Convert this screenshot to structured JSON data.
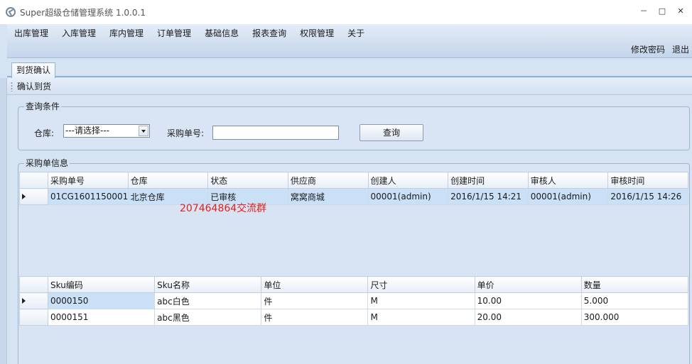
{
  "window": {
    "title": "Super超级仓储管理系统 1.0.0.1",
    "controls": [
      "－",
      "□",
      "✕"
    ]
  },
  "menu": {
    "items": [
      "出库管理",
      "入库管理",
      "库内管理",
      "订单管理",
      "基础信息",
      "报表查询",
      "权限管理",
      "关于"
    ]
  },
  "userbar": {
    "change_password": "修改密码",
    "logout": "退出"
  },
  "tabs": [
    {
      "label": "到货确认",
      "active": true
    }
  ],
  "toolbar": {
    "confirm_label": "确认到货"
  },
  "query": {
    "group_title": "查询条件",
    "warehouse_label": "仓库:",
    "warehouse_value": "---请选择---",
    "po_label": "采购单号:",
    "po_value": "",
    "search_label": "查询"
  },
  "po_info": {
    "group_title": "采购单信息",
    "columns": [
      "采购单号",
      "仓库",
      "状态",
      "供应商",
      "创建人",
      "创建时间",
      "审核人",
      "审核时间"
    ],
    "rows": [
      [
        "01CG1601150001",
        "北京仓库",
        "已审核",
        "窝窝商城",
        "00001(admin)",
        "2016/1/15 14:21",
        "00001(admin)",
        "2016/1/15 14:26"
      ]
    ]
  },
  "sku_grid": {
    "columns": [
      "Sku编码",
      "Sku名称",
      "单位",
      "尺寸",
      "单价",
      "数量"
    ],
    "rows": [
      [
        "0000150",
        "abc白色",
        "件",
        "M",
        "10.00",
        "5.000"
      ],
      [
        "0000151",
        "abc黑色",
        "件",
        "M",
        "20.00",
        "300.000"
      ]
    ]
  },
  "watermark": "207464864交流群"
}
